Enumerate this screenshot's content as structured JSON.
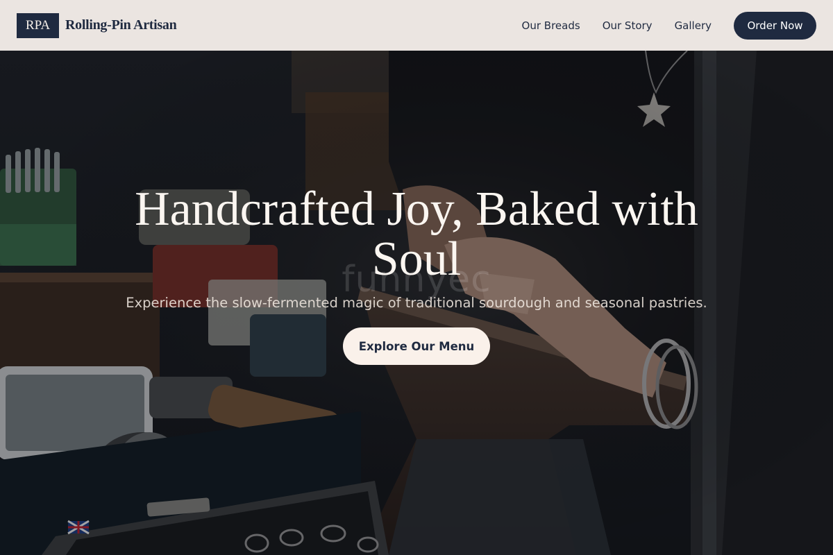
{
  "header": {
    "logo_text": "RPA",
    "brand_name": "Rolling-Pin Artisan",
    "nav": [
      {
        "label": "Our Breads"
      },
      {
        "label": "Our Story"
      },
      {
        "label": "Gallery"
      }
    ],
    "cta_label": "Order Now"
  },
  "hero": {
    "title": "Handcrafted Joy, Baked with Soul",
    "subtitle": "Experience the slow-fermented magic of traditional sourdough and seasonal pastries.",
    "cta_label": "Explore Our Menu",
    "watermark": "funnyec",
    "background_image": "workshop-hands-anvil-photo"
  },
  "colors": {
    "navy": "#1f2a40",
    "header_bg": "#ebe5e1",
    "cream": "#faf1ea"
  }
}
